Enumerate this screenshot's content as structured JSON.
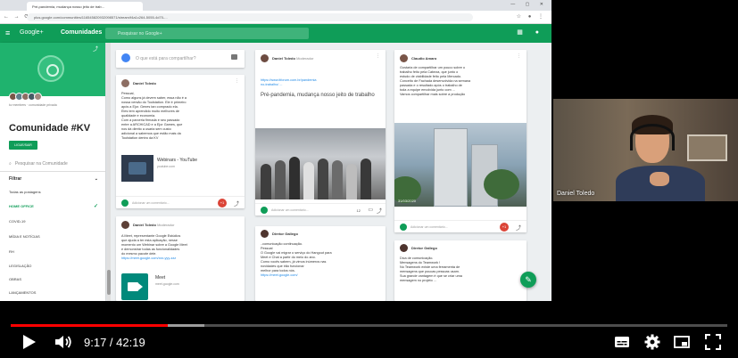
{
  "browser": {
    "tab_title": "Pré-pandemia, mudança nosso jeito de trab...",
    "url": "plus.google.com/communities/116545820932098571/stream/f4a1c264-5055-4d70-..."
  },
  "gplus": {
    "logo": "Google+",
    "section": "Comunidades",
    "search_placeholder": "Pesquisar no Google+"
  },
  "community": {
    "title": "Comunidade #KV",
    "members_line": "kv members · comunidade privada",
    "join_button": "LIGUE/SAIR",
    "search_placeholder": "Pesquisar na Comunidade",
    "filter_label": "Filtrar",
    "categories": [
      "Todas as postagens",
      "HOME OFFICE",
      "COVID-19",
      "MÍDIA E NOTÍCIAS",
      "RH",
      "LEGISLAÇÃO",
      "OBRAS",
      "LANÇAMENTOS"
    ],
    "active_category": "HOME OFFICE"
  },
  "compose": {
    "placeholder": "O que está para compartilhar?"
  },
  "posts": {
    "p1": {
      "author": "Daniel Toledo",
      "lines": [
        "Pessoal,",
        "Como alguns já devem saber, essa não é a",
        "nossa versão do Toolstation. Ele é primeiro",
        "após a Ejor. Genes tan comprado ela.",
        "Eles tem aprendido muito melhores de",
        "qualidade e economia.",
        "Com a parceria firmada e seu passado",
        "entre a ARCHICAD e a Ejor Games, que",
        "nos dá direito a usaria sem custo",
        "adicional a sabemos que estão mais da",
        "Toolstation dentro da KV"
      ],
      "yt_title": "Webinars - YouTube",
      "yt_sub": "youtube.com",
      "comment": "Adicionar um comentário..."
    },
    "p2": {
      "author": "Daniel Toledo",
      "role": "Moderador",
      "lines": [
        "A Meet, representante Google Estúdios",
        "que ajuda a ter esta aplicação, nesse",
        "momento um Webinar sobre a Google Meet",
        "e demonstrar todas as funcionalidades",
        "do mesmo pacote dele."
      ],
      "link": "https://meet.google.com/xxx-yyy-zzz",
      "meet_title": "Meet",
      "meet_sub": "meet.google.com"
    },
    "p3": {
      "author": "Daniel Toledo",
      "role": "Moderador",
      "link_lines": [
        "https://www.itforum.com.br/pandemia",
        "no-trabalho/ ..."
      ],
      "headline": "Pré-pandemia, mudança nosso jeito de trabalho",
      "count": "12",
      "comment": "Adicionar um comentário..."
    },
    "p4": {
      "author": "Diretor Gallego",
      "lines": [
        "..comunicação continuação.",
        "Pessoal",
        "O Google vai migrar o serviço do Hangout para",
        "Meet e Chat a partir do meio do ano.",
        "Como vocês sabem, já vimos inúmeros nas",
        "novidades que irão funcionar",
        "melhor para todos nós."
      ],
      "link": "https://meet.google.com/"
    },
    "p5": {
      "author": "Claudio Amaro",
      "lines": [
        "Gostaria de compartilhar um pouco sobre o",
        "trabalho feito pela Cabeza, que junto o",
        "estudo de viabilidade feito pela Mercado.",
        "",
        "Conceito de Fachada desenvolvida na semana",
        "passada e o resultado após o trabalho de",
        "toda a equipe envolvida junto com ...",
        "Vamos compartilhar mais sobre a produção"
      ],
      "photo_date": "31/03/2020",
      "comment": "Adicionar um comentário..."
    },
    "p6": {
      "author": "Diretor Gallego",
      "lines": [
        "Dica de comunicação.",
        "Mensagens do Teamwork !",
        "",
        "No Teamwork existe uma ferramenta de",
        "mensagens que poucas pessoas usam.",
        "Sua grande vantagem é que se criar uma",
        "mensagem no projeto ..."
      ]
    }
  },
  "webcam": {
    "name": "Daniel Toledo"
  },
  "player": {
    "current_time": "9:17",
    "duration": "42:19",
    "played_fraction": 0.219,
    "loaded_fraction": 0.27
  },
  "colors": {
    "accent": "#0f9d58",
    "progress": "#ff0000"
  }
}
